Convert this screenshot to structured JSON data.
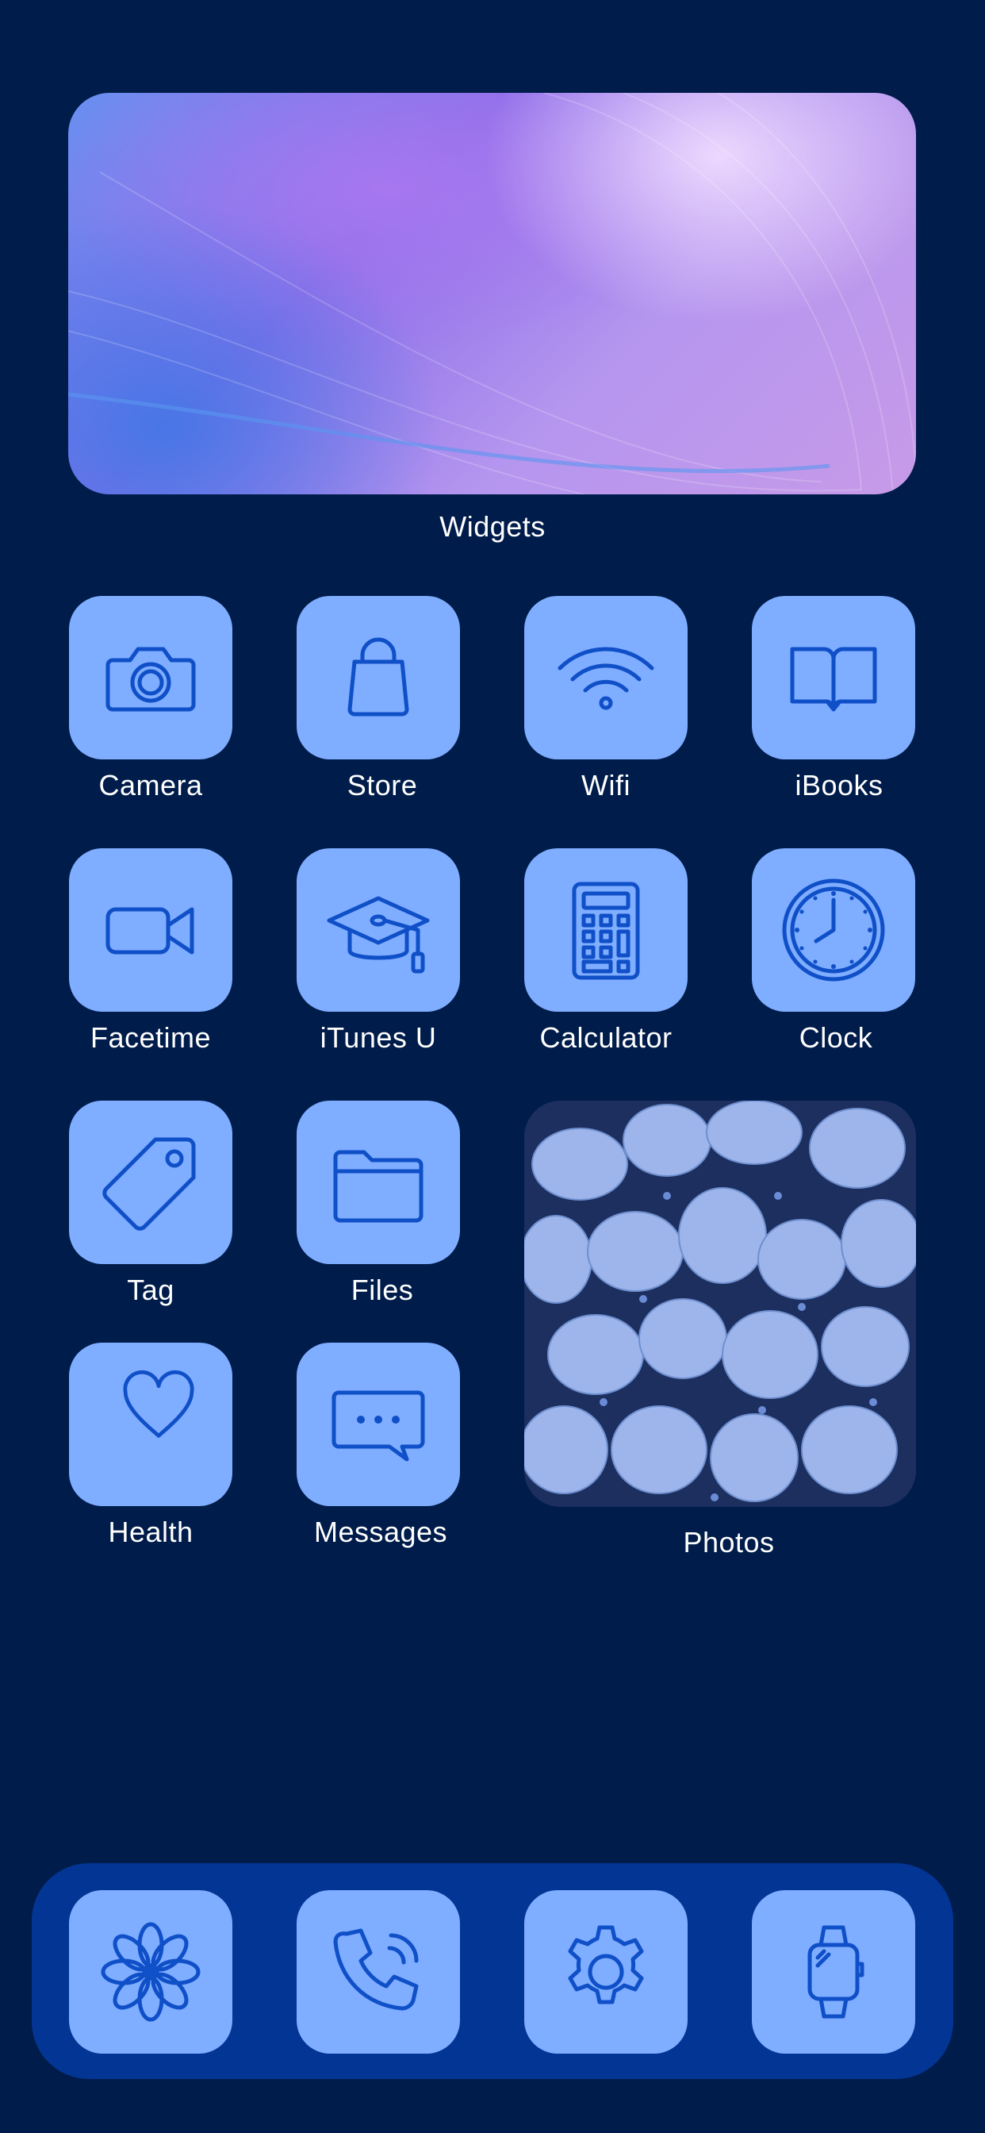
{
  "widget": {
    "label": "Widgets"
  },
  "apps": [
    {
      "label": "Camera",
      "icon": "camera-icon"
    },
    {
      "label": "Store",
      "icon": "shopping-bag-icon"
    },
    {
      "label": "Wifi",
      "icon": "wifi-icon"
    },
    {
      "label": "iBooks",
      "icon": "open-book-icon"
    },
    {
      "label": "Facetime",
      "icon": "video-camera-icon"
    },
    {
      "label": "iTunes U",
      "icon": "graduation-cap-icon"
    },
    {
      "label": "Calculator",
      "icon": "calculator-icon"
    },
    {
      "label": "Clock",
      "icon": "clock-icon"
    },
    {
      "label": "Tag",
      "icon": "tag-icon"
    },
    {
      "label": "Files",
      "icon": "folder-icon"
    },
    {
      "label": "Health",
      "icon": "heart-icon"
    },
    {
      "label": "Messages",
      "icon": "chat-bubble-icon"
    }
  ],
  "photos": {
    "label": "Photos"
  },
  "dock": [
    {
      "icon": "flower-icon"
    },
    {
      "icon": "phone-icon"
    },
    {
      "icon": "gear-icon"
    },
    {
      "icon": "watch-icon"
    }
  ],
  "colors": {
    "background": "#001c4a",
    "icon_tile": "#7fadff",
    "icon_glyph": "#0f4fc7",
    "dock": "#023594",
    "label": "#ffffff"
  }
}
